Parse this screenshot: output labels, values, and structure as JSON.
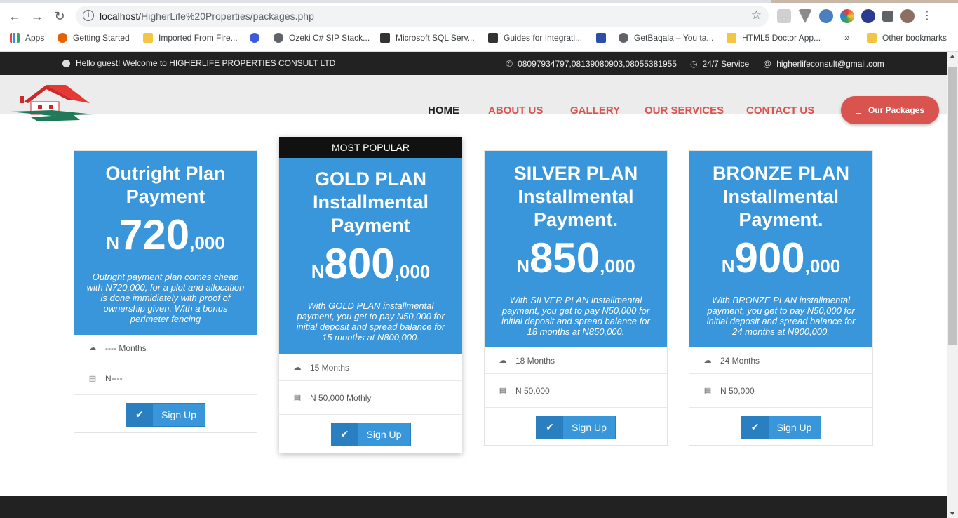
{
  "browser": {
    "url_host": "localhost/",
    "url_path": "HigherLife%20Properties/packages.php",
    "bookmarks": [
      {
        "label": "Apps",
        "color": "#4285f4"
      },
      {
        "label": "Getting Started",
        "color": "#e66000"
      },
      {
        "label": "Imported From Fire...",
        "color": "#f4c542"
      },
      {
        "label": "",
        "color": "#3b5bdb"
      },
      {
        "label": "Ozeki C# SIP Stack...",
        "color": "#5f6368"
      },
      {
        "label": "Microsoft SQL Serv...",
        "color": "#333333"
      },
      {
        "label": "Guides for Integrati...",
        "color": "#333333"
      },
      {
        "label": "",
        "color": "#2b4fa8"
      },
      {
        "label": "GetBaqala – You ta...",
        "color": "#5f6368"
      },
      {
        "label": "HTML5 Doctor App...",
        "color": "#f4c542"
      },
      {
        "label": "»",
        "color": ""
      },
      {
        "label": "Other bookmarks",
        "color": "#f4c542"
      }
    ]
  },
  "topbar": {
    "welcome": "Hello guest! Welcome to HIGHERLIFE PROPERTIES CONSULT LTD",
    "phones": "08097934797,08139080903,08055381955",
    "service": "24/7 Service",
    "email": "higherlifeconsult@gmail.com"
  },
  "nav": {
    "home": "HOME",
    "about": "ABOUT US",
    "gallery": "GALLERY",
    "services": "OUR SERVICES",
    "contact": "CONTACT US",
    "packages": "Our Packages"
  },
  "plans": [
    {
      "title_line1": "Outright Plan",
      "title_line2": "Payment",
      "currency": "N",
      "price_main": "720",
      "price_tail": ",000",
      "description": "Outright payment plan comes cheap with N720,000, for a plot and allocation is done immidiately with proof of ownership given. With a bonus perimeter fencing",
      "months": "---- Months",
      "amount": "N----",
      "signup": "Sign Up"
    },
    {
      "badge": "MOST POPULAR",
      "title_line1": "GOLD PLAN",
      "title_line2": "Installmental",
      "title_line3": "Payment",
      "currency": "N",
      "price_main": "800",
      "price_tail": ",000",
      "description": "With GOLD PLAN installmental payment, you get to pay N50,000 for initial deposit and spread balance for 15 months at N800,000.",
      "months": "15 Months",
      "amount": "N 50,000 Mothly",
      "signup": "Sign Up"
    },
    {
      "title_line1": "SILVER PLAN",
      "title_line2": "Installmental",
      "title_line3": "Payment.",
      "currency": "N",
      "price_main": "850",
      "price_tail": ",000",
      "description": "With SILVER PLAN installmental payment, you get to pay N50,000 for initial deposit and spread balance for 18 months at N850,000.",
      "months": "18 Months",
      "amount": "N 50,000",
      "signup": "Sign Up"
    },
    {
      "title_line1": "BRONZE PLAN",
      "title_line2": "Installmental",
      "title_line3": "Payment.",
      "currency": "N",
      "price_main": "900",
      "price_tail": ",000",
      "description": "With BRONZE PLAN installmental payment, you get to pay N50,000 for initial deposit and spread balance for 24 months at N900,000.",
      "months": "24 Months",
      "amount": "N 50,000",
      "signup": "Sign Up"
    }
  ],
  "colors": {
    "plan_blue": "#3a96db",
    "accent_red": "#d9534f",
    "topbar_dark": "#222222"
  }
}
